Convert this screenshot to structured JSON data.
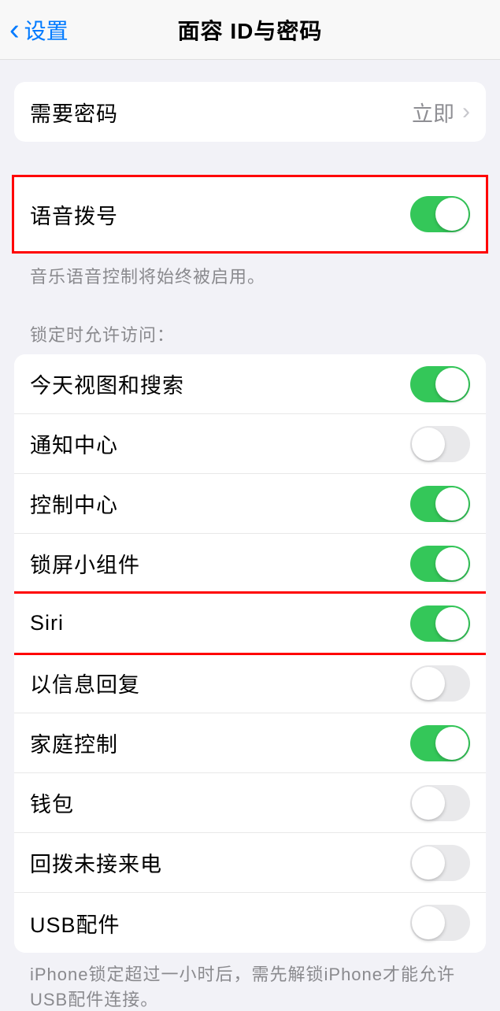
{
  "nav": {
    "back_label": "设置",
    "title": "面容 ID与密码"
  },
  "passcode": {
    "label": "需要密码",
    "value": "立即"
  },
  "voice_dial": {
    "label": "语音拨号",
    "footer": "音乐语音控制将始终被启用。",
    "on": true
  },
  "lock_access": {
    "header": "锁定时允许访问：",
    "items": [
      {
        "label": "今天视图和搜索",
        "on": true,
        "highlighted": false
      },
      {
        "label": "通知中心",
        "on": false,
        "highlighted": false
      },
      {
        "label": "控制中心",
        "on": true,
        "highlighted": false
      },
      {
        "label": "锁屏小组件",
        "on": true,
        "highlighted": false
      },
      {
        "label": "Siri",
        "on": true,
        "highlighted": true
      },
      {
        "label": "以信息回复",
        "on": false,
        "highlighted": false
      },
      {
        "label": "家庭控制",
        "on": true,
        "highlighted": false
      },
      {
        "label": "钱包",
        "on": false,
        "highlighted": false
      },
      {
        "label": "回拨未接来电",
        "on": false,
        "highlighted": false
      },
      {
        "label": "USB配件",
        "on": false,
        "highlighted": false
      }
    ],
    "footer": "iPhone锁定超过一小时后，需先解锁iPhone才能允许USB配件连接。"
  }
}
